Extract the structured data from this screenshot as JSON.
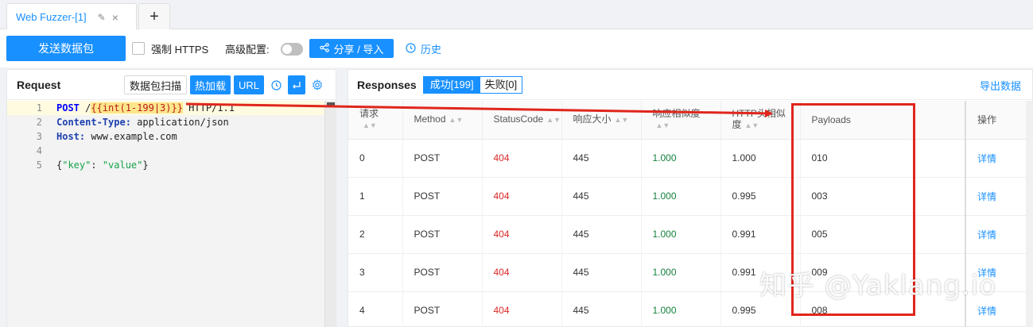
{
  "tab": {
    "label": "Web Fuzzer-[1]",
    "edit_icon": "pencil-icon",
    "close_icon": "×",
    "add_icon": "+"
  },
  "toolbar": {
    "send_label": "发送数据包",
    "https_label": "强制 HTTPS",
    "https_checked": false,
    "advanced_label": "高级配置:",
    "advanced_on": false,
    "share_label": "分享 / 导入",
    "history_label": "历史"
  },
  "request": {
    "title": "Request",
    "scan_label": "数据包扫描",
    "hotload_label": "热加载",
    "url_label": "URL",
    "lines": [
      {
        "no": "1",
        "method": "POST",
        "space": " /",
        "template": "{{int(1-199|3)}}",
        "rest": " HTTP/1.1"
      },
      {
        "no": "2",
        "header": "Content-Type:",
        "value": " application/json"
      },
      {
        "no": "3",
        "header": "Host:",
        "value": " www.example.com"
      },
      {
        "no": "4"
      },
      {
        "no": "5",
        "p1": "{",
        "k": "\"key\"",
        "p2": ": ",
        "v": "\"value\"",
        "p3": "}"
      }
    ]
  },
  "responses": {
    "title": "Responses",
    "success_label": "成功[199]",
    "fail_label": "失败[0]",
    "export_label": "导出数据",
    "columns": [
      "请求",
      "Method",
      "StatusCode",
      "响应大小",
      "响应相似度",
      "HTTP头相似度",
      "Payloads",
      "操作"
    ],
    "rows": [
      {
        "req": "0",
        "method": "POST",
        "status": "404",
        "size": "445",
        "sim": "1.000",
        "hsim": "1.000",
        "payload": "010",
        "op": "详情"
      },
      {
        "req": "1",
        "method": "POST",
        "status": "404",
        "size": "445",
        "sim": "1.000",
        "hsim": "0.995",
        "payload": "003",
        "op": "详情"
      },
      {
        "req": "2",
        "method": "POST",
        "status": "404",
        "size": "445",
        "sim": "1.000",
        "hsim": "0.991",
        "payload": "005",
        "op": "详情"
      },
      {
        "req": "3",
        "method": "POST",
        "status": "404",
        "size": "445",
        "sim": "1.000",
        "hsim": "0.991",
        "payload": "009",
        "op": "详情"
      },
      {
        "req": "4",
        "method": "POST",
        "status": "404",
        "size": "445",
        "sim": "1.000",
        "hsim": "0.995",
        "payload": "008",
        "op": "详情"
      }
    ]
  },
  "watermark": "知乎 @Yaklang.io",
  "colors": {
    "primary": "#1890ff",
    "annotation_red": "#e0261c",
    "status_red": "#dc2626",
    "similarity_green": "#15803d"
  }
}
